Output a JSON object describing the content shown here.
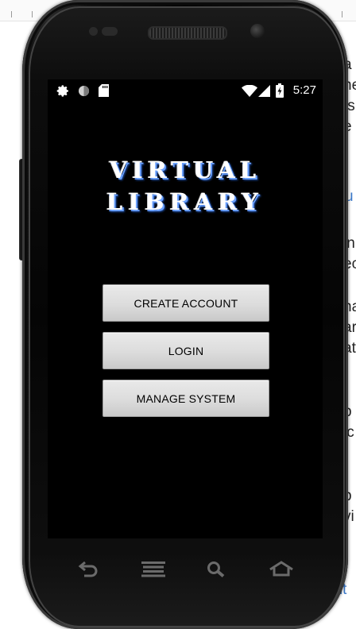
{
  "background_doc": {
    "fragments": [
      "a",
      "he",
      "ts",
      "e",
      "u",
      "in",
      "ec",
      "na",
      "ar",
      "at",
      "p",
      "ic",
      "p",
      "vi",
      "ent"
    ]
  },
  "status_bar": {
    "time": "5:27",
    "left_icons": [
      "gear-icon",
      "circle-icon",
      "sd-card-icon"
    ],
    "right_icons": [
      "wifi-icon",
      "signal-icon",
      "battery-charging-icon"
    ]
  },
  "app": {
    "title_line1": "VIRTUAL",
    "title_line2": "LIBRARY",
    "buttons": {
      "create_account": "CREATE ACCOUNT",
      "login": "LOGIN",
      "manage_system": "MANAGE SYSTEM"
    }
  },
  "nav_bar": {
    "icons": [
      "back-icon",
      "menu-icon",
      "search-icon",
      "home-icon"
    ]
  },
  "colors": {
    "screen_bg": "#000000",
    "button_bg": "#dcdcdc",
    "button_text": "#000000",
    "title_text": "#ffffff",
    "title_shadow": "#6aa0ff",
    "link_blue": "#3a78c9"
  }
}
